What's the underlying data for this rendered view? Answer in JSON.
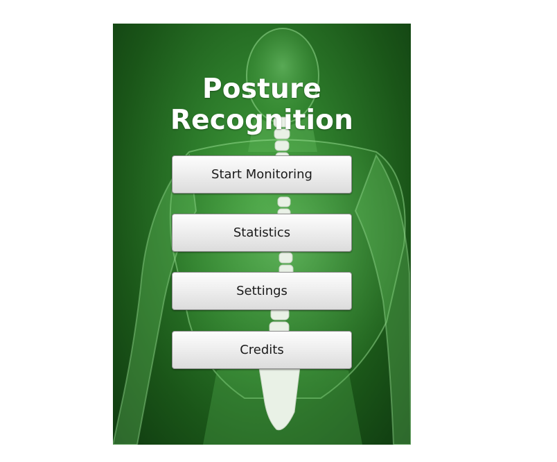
{
  "app": {
    "title": "Posture Recognition"
  },
  "menu": {
    "start_monitoring": "Start Monitoring",
    "statistics": "Statistics",
    "settings": "Settings",
    "credits": "Credits"
  },
  "colors": {
    "background_green": "#2c7a2a",
    "button_face": "#efefef",
    "spine": "#e8efe6"
  }
}
